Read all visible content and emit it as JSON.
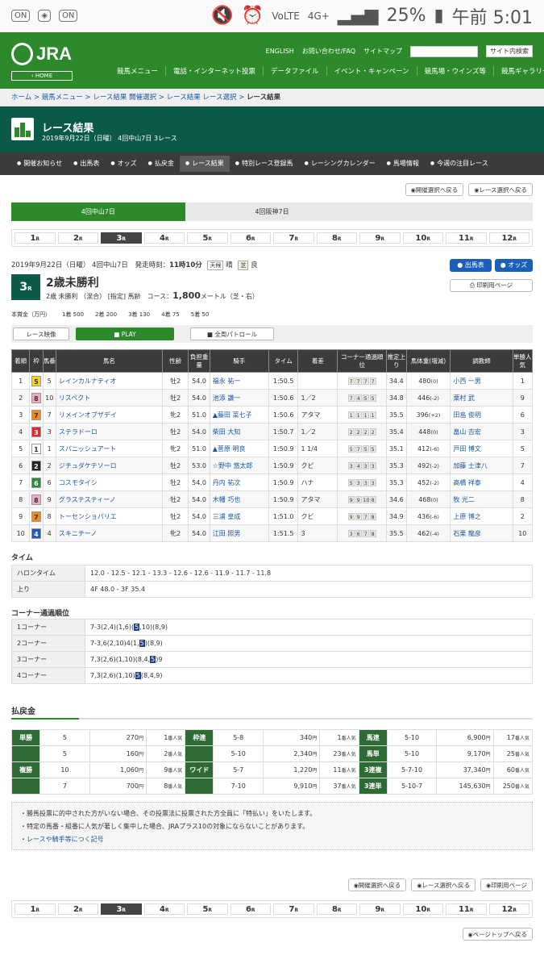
{
  "status": {
    "battery": "25%",
    "time": "午前 5:01",
    "network": "4G+",
    "volte": "VoLTE",
    "left_icons": [
      "ON",
      "ON"
    ]
  },
  "header": {
    "logo": "JRA",
    "home": "‹ HOME",
    "links": [
      "ENGLISH",
      "お問い合わせ/FAQ",
      "サイトマップ"
    ],
    "search_btn": "サイト内検索",
    "nav": [
      "競馬メニュー",
      "電話・インターネット投票",
      "データファイル",
      "イベント・キャンペーン",
      "競馬場・ウインズ等",
      "競馬ギャラリー"
    ]
  },
  "breadcrumb": [
    "ホーム",
    "競馬メニュー",
    "レース結果 開催選択",
    "レース結果 レース選択",
    "レース結果"
  ],
  "page": {
    "title": "レース結果",
    "subtitle": "2019年9月22日（日曜） 4回中山7日 3レース"
  },
  "subnav": [
    "開催お知らせ",
    "出馬表",
    "オッズ",
    "払戻金",
    "レース結果",
    "特別レース登録馬",
    "レーシングカレンダー",
    "馬場情報",
    "今週の注目レース"
  ],
  "select_buttons": [
    "開催選択へ戻る",
    "レース選択へ戻る"
  ],
  "meetings": [
    "4回中山7日",
    "4回阪神7日",
    ""
  ],
  "races": [
    "1",
    "2",
    "3",
    "4",
    "5",
    "6",
    "7",
    "8",
    "9",
    "10",
    "11",
    "12"
  ],
  "race_unit": "R",
  "race": {
    "date": "2019年9月22日（日曜） 4回中山7日",
    "start_label": "発走時刻：",
    "start": "11時10分",
    "weather_l": "天候",
    "weather": "晴",
    "track_l": "芝",
    "track": "良",
    "num": "3",
    "num_unit": "R",
    "name": "2歳未勝利",
    "cond": "2歳 未勝利 （混合） [指定] 馬齢",
    "course_l": "コース：",
    "course": "1,800",
    "course_u": "メートル（芝・右）"
  },
  "action_buttons": {
    "entries": "出馬表",
    "odds": "オッズ",
    "print": "印刷用ページ"
  },
  "prize": [
    "本賞金（万円）",
    "1着 500",
    "2着 200",
    "3着 130",
    "4着 75",
    "5着 50"
  ],
  "video": {
    "label": "レース映像",
    "play": "PLAY",
    "patrol": "全周パトロール"
  },
  "headers": [
    "着順",
    "枠",
    "馬番",
    "馬名",
    "性齢",
    "負担重量",
    "騎手",
    "タイム",
    "着差",
    "コーナー通過順位",
    "推定上り",
    "馬体重(増減)",
    "調教師",
    "単勝人気"
  ],
  "rows": [
    [
      "1",
      "5",
      "5",
      "レインカルナティオ",
      "牡2",
      "54.0",
      "福永 祐一",
      "1:50.5",
      "",
      "7777",
      "34.4",
      "480",
      "(0)",
      "小西 一男",
      "1"
    ],
    [
      "2",
      "8",
      "10",
      "リスペクト",
      "牡2",
      "54.0",
      "池添 謙一",
      "1:50.6",
      "1／2",
      "7455",
      "34.8",
      "446",
      "(-2)",
      "栗村 武",
      "9"
    ],
    [
      "3",
      "7",
      "7",
      "リメインオブザデイ",
      "牝2",
      "51.0",
      "▲藤田 菜七子",
      "1:50.6",
      "アタマ",
      "1111",
      "35.5",
      "396",
      "(+2)",
      "田島 俊明",
      "6"
    ],
    [
      "4",
      "3",
      "3",
      "ステラドーロ",
      "牡2",
      "54.0",
      "柴田 大知",
      "1:50.7",
      "1／2",
      "2222",
      "35.4",
      "448",
      "(0)",
      "畠山 吉宏",
      "3"
    ],
    [
      "5",
      "1",
      "1",
      "スパニッシュアート",
      "牝2",
      "51.0",
      "▲菅原 明良",
      "1:50.9",
      "1 1/4",
      "5755",
      "35.1",
      "412",
      "(-6)",
      "戸田 博文",
      "5"
    ],
    [
      "6",
      "2",
      "2",
      "ジチュダケテソーロ",
      "牡2",
      "53.0",
      "☆野中 悠太郎",
      "1:50.9",
      "クビ",
      "3433",
      "35.3",
      "492",
      "(-2)",
      "加藤 士津八",
      "7"
    ],
    [
      "7",
      "6",
      "6",
      "コスモタイシ",
      "牡2",
      "54.0",
      "丹内 祐次",
      "1:50.9",
      "ハナ",
      "5333",
      "35.3",
      "452",
      "(-2)",
      "高橋 祥泰",
      "4"
    ],
    [
      "8",
      "8",
      "9",
      "グラステスティーノ",
      "牡2",
      "54.0",
      "木幡 巧也",
      "1:50.9",
      "アタマ",
      "99108",
      "34.6",
      "468",
      "(0)",
      "牧 光二",
      "8"
    ],
    [
      "9",
      "7",
      "8",
      "トーセンショパリエ",
      "牡2",
      "54.0",
      "三浦 皇成",
      "1:51.0",
      "クビ",
      "9978",
      "34.9",
      "436",
      "(-6)",
      "上原 博之",
      "2"
    ],
    [
      "10",
      "4",
      "4",
      "スキニチーノ",
      "牝2",
      "54.0",
      "江田 照男",
      "1:51.5",
      "3",
      "3678",
      "35.5",
      "462",
      "(-4)",
      "石栗 龍彦",
      "10"
    ]
  ],
  "waku_colors": {
    "1": "#ffffff",
    "2": "#222222",
    "3": "#d82c2c",
    "4": "#2357b0",
    "5": "#f2d51c",
    "6": "#2a8a3a",
    "7": "#f08a1c",
    "8": "#f2a8c8"
  },
  "time_section": {
    "title": "タイム",
    "rows": [
      [
        "ハロンタイム",
        "12.0 - 12.5 - 12.1 - 13.3 - 12.6 - 12.6 - 11.9 - 11.7 - 11.8"
      ],
      [
        "上り",
        "4F 48.0 - 3F 35.4"
      ]
    ]
  },
  "corner_section": {
    "title": "コーナー通過順位",
    "rows": [
      [
        "1コーナー",
        "7-3(2,4)(1,6)(",
        "5",
        ",10)(8,9)"
      ],
      [
        "2コーナー",
        "7-3,6(2,10)4(1,",
        "5",
        ")(8,9)"
      ],
      [
        "3コーナー",
        "7,3(2,6)(1,10)(8,4,",
        "5",
        ")9"
      ],
      [
        "4コーナー",
        "7,3(2,6)(1,10)",
        "5",
        "(8,4,9)"
      ]
    ]
  },
  "payout": {
    "title": "払戻金",
    "yen": "円",
    "ninki": "番人気",
    "rows": [
      [
        "単勝",
        "5",
        "270",
        "1",
        "枠連",
        "5-8",
        "340",
        "1",
        "馬連",
        "5-10",
        "6,900",
        "17"
      ],
      [
        "",
        "5",
        "160",
        "2",
        "",
        "5-10",
        "2,340",
        "23",
        "馬単",
        "5-10",
        "9,170",
        "25"
      ],
      [
        "複勝",
        "10",
        "1,060",
        "9",
        "ワイド",
        "5-7",
        "1,220",
        "11",
        "3連複",
        "5-7-10",
        "37,340",
        "60"
      ],
      [
        "",
        "7",
        "700",
        "8",
        "",
        "7-10",
        "9,910",
        "37",
        "3連単",
        "5-10-7",
        "145,630",
        "250"
      ]
    ]
  },
  "notes": [
    "勝馬投票に的中された方がいない場合、その投票法に投票された方全員に「特払い」をいたします。",
    "特定の馬番・組番に人気が著しく集中した場合、JRAプラス10の対象にならないことがあります。",
    "レースや騎手等につく記号"
  ],
  "bottom_buttons": [
    "開催選択へ戻る",
    "レース選択へ戻る",
    "印刷用ページ"
  ],
  "pagetop": "ページトップへ戻る"
}
